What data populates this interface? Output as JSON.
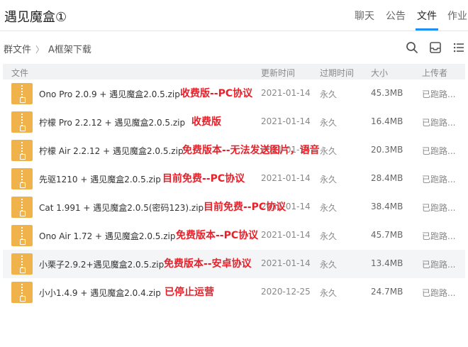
{
  "header": {
    "title": "遇见魔盒①",
    "tabs": [
      {
        "label": "聊天"
      },
      {
        "label": "公告"
      },
      {
        "label": "文件",
        "active": true
      },
      {
        "label": "作业"
      }
    ],
    "accent_color": "#1e8ff5"
  },
  "breadcrumb": {
    "root": "群文件",
    "folder": "A框架下载"
  },
  "toolbar": {
    "icons": [
      "search-icon",
      "inbox-icon",
      "list-view-icon"
    ]
  },
  "table": {
    "columns": {
      "name": "文件",
      "updated": "更新时间",
      "expiry": "过期时间",
      "size": "大小",
      "uploader": "上传者"
    },
    "rows": [
      {
        "name": "Ono Pro 2.0.9 + 遇见魔盒2.0.5.zip",
        "annotation": "收费版--PC协议",
        "updated": "2021-01-14",
        "expiry": "永久",
        "size": "45.3MB",
        "uploader": "已跑路..."
      },
      {
        "name": "柠檬 Pro 2.2.12 + 遇见魔盒2.0.5.zip",
        "annotation": "收费版",
        "updated": "2021-01-14",
        "expiry": "永久",
        "size": "16.4MB",
        "uploader": "已跑路..."
      },
      {
        "name": "柠檬 Air 2.2.12 + 遇见魔盒2.0.5.zip",
        "annotation": "免费版本--无法发送图片，语音",
        "updated": "2021-01-14",
        "expiry": "永久",
        "size": "20.3MB",
        "uploader": "已跑路..."
      },
      {
        "name": "先驱1210 + 遇见魔盒2.0.5.zip",
        "annotation": "目前免费--PC协议",
        "updated": "2021-01-14",
        "expiry": "永久",
        "size": "28.4MB",
        "uploader": "已跑路..."
      },
      {
        "name": "Cat 1.991 +  遇见魔盒2.0.5(密码123).zip",
        "annotation": "目前免费--PC协议",
        "updated": "2021-01-14",
        "expiry": "永久",
        "size": "38.4MB",
        "uploader": "已跑路..."
      },
      {
        "name": "Ono Air 1.72 + 遇见魔盒2.0.5.zip",
        "annotation": "免费版本--PC协议",
        "updated": "2021-01-14",
        "expiry": "永久",
        "size": "45.7MB",
        "uploader": "已跑路..."
      },
      {
        "name": "小栗子2.9.2+遇见魔盒2.0.5.zip",
        "annotation": "免费版本--安卓协议",
        "updated": "2021-01-14",
        "expiry": "永久",
        "size": "13.4MB",
        "uploader": "已跑路..."
      },
      {
        "name": "小小1.4.9 + 遇见魔盒2.0.4.zip",
        "annotation": "已停止运营",
        "updated": "2020-12-25",
        "expiry": "永久",
        "size": "24.7MB",
        "uploader": "已跑路..."
      }
    ]
  }
}
